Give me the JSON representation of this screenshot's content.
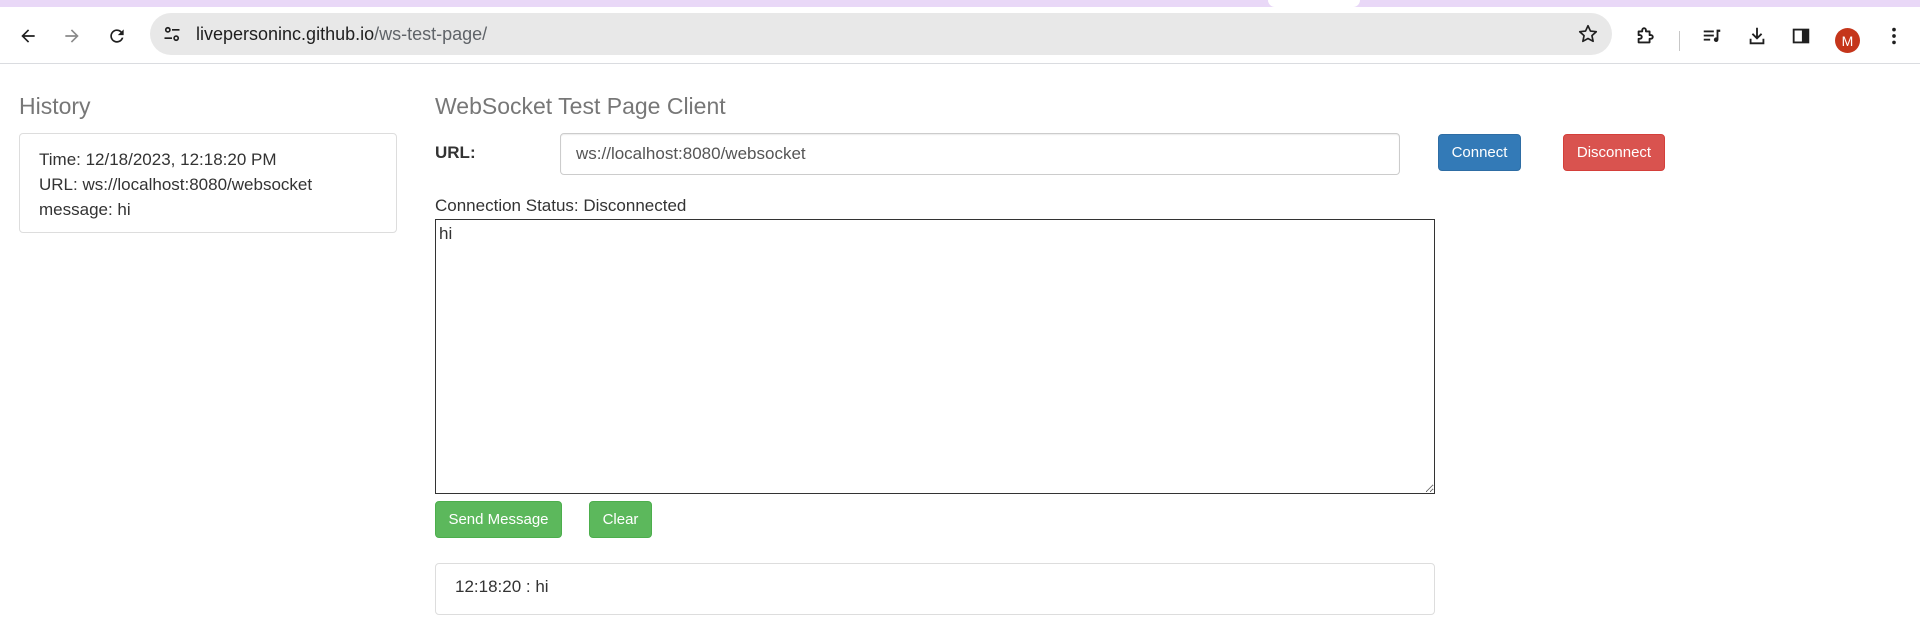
{
  "browser": {
    "url_host": "livepersoninc.github.io",
    "url_path": "/ws-test-page/",
    "profile_initial": "M",
    "icons": {
      "back": "arrow-left-icon",
      "forward": "arrow-right-icon",
      "reload": "reload-icon",
      "site_info": "tune-icon",
      "bookmark": "star-icon",
      "extensions": "puzzle-icon",
      "media": "playlist-icon",
      "downloads": "download-icon",
      "side_panel": "side-panel-icon",
      "menu": "more-vert-icon"
    }
  },
  "history": {
    "title": "History",
    "entries": [
      {
        "time": "Time: 12/18/2023, 12:18:20 PM",
        "url": "URL: ws://localhost:8080/websocket",
        "message": "message: hi"
      }
    ]
  },
  "client": {
    "title": "WebSocket Test Page Client",
    "url_label": "URL:",
    "url_value": "ws://localhost:8080/websocket",
    "connect_label": "Connect",
    "disconnect_label": "Disconnect",
    "status_text": "Connection Status: Disconnected",
    "message_text": "hi",
    "send_label": "Send Message",
    "clear_label": "Clear",
    "log": [
      "12:18:20 : hi"
    ]
  },
  "colors": {
    "primary": "#337ab7",
    "danger": "#d9534f",
    "success": "#5cb85c",
    "avatar": "#c5361b",
    "tabstrip": "#e9d8f7"
  }
}
